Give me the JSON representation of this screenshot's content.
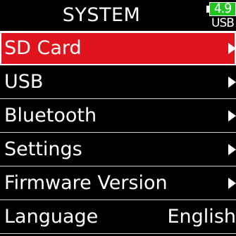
{
  "header": {
    "title": "SYSTEM",
    "battery": {
      "level": "4.9",
      "source": "USB",
      "color": "#22c322"
    }
  },
  "menu": {
    "items": [
      {
        "label": "SD Card",
        "icon": "chevron-right-icon",
        "selected": true
      },
      {
        "label": "USB",
        "icon": "chevron-right-icon"
      },
      {
        "label": "Bluetooth",
        "icon": "chevron-right-icon"
      },
      {
        "label": "Settings",
        "icon": "chevron-right-icon"
      },
      {
        "label": "Firmware Version",
        "icon": "chevron-right-icon"
      },
      {
        "label": "Language",
        "value": "English"
      }
    ]
  },
  "colors": {
    "background": "#000000",
    "selection": "#e0141e",
    "text": "#ffffff"
  }
}
